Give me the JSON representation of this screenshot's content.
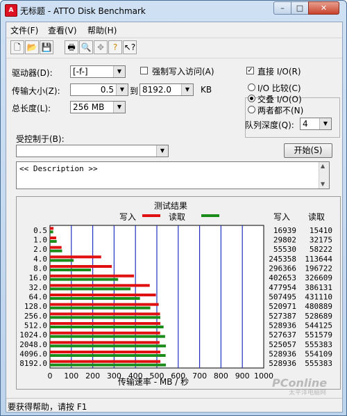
{
  "window": {
    "title": "无标题 - ATTO Disk Benchmark",
    "app_icon": "atto-icon",
    "minimize": "–",
    "maximize": "□",
    "close": "✕"
  },
  "menu": [
    "文件(F)",
    "查看(V)",
    "帮助(H)"
  ],
  "toolbar": [
    "new-icon",
    "open-icon",
    "save-icon",
    "print-icon",
    "print-preview-icon",
    "move-icon",
    "help-icon",
    "context-help-icon"
  ],
  "form": {
    "drive_label": "驱动器(D):",
    "drive_value": "[-f-]",
    "force_write_label": "强制写入访问(A)",
    "transfer_label": "传输大小(Z):",
    "transfer_from": "0.5",
    "to_label": "到",
    "transfer_to": "8192.0",
    "kb_label": "KB",
    "total_length_label": "总长度(L):",
    "total_length_value": "256 MB",
    "direct_io_label": "直接 I/O(R)",
    "io_compare_label": "I/O 比较(C)",
    "overlapped_io_label": "交叠 I/O(O)",
    "neither_label": "两者都不(N)",
    "queue_depth_label": "队列深度(Q):",
    "queue_depth_value": "4",
    "controlled_by_label": "受控制于(B):",
    "controlled_by_value": "",
    "start_button": "开始(S)",
    "description": "<< Description >>"
  },
  "results": {
    "title": "测试结果",
    "write_label": "写入",
    "read_label": "读取",
    "col_write": "写入",
    "col_read": "读取",
    "axis_label": "传输速率 - MB / 秒"
  },
  "chart_data": {
    "type": "bar",
    "orientation": "horizontal",
    "categories": [
      "0.5",
      "1.0",
      "2.0",
      "4.0",
      "8.0",
      "16.0",
      "32.0",
      "64.0",
      "128.0",
      "256.0",
      "512.0",
      "1024.0",
      "2048.0",
      "4096.0",
      "8192.0"
    ],
    "series": [
      {
        "name": "写入",
        "color": "#e01010",
        "values": [
          16939,
          29802,
          55530,
          245358,
          296366,
          402653,
          477954,
          507495,
          520971,
          527387,
          528936,
          527637,
          525057,
          528936,
          528936
        ]
      },
      {
        "name": "读取",
        "color": "#1a8c1a",
        "values": [
          15410,
          32175,
          58222,
          113644,
          196722,
          326609,
          386131,
          431110,
          480889,
          528689,
          544125,
          551579,
          555383,
          554109,
          555383
        ]
      }
    ],
    "xticks": [
      "0",
      "100",
      "200",
      "300",
      "400",
      "500",
      "600",
      "700",
      "800",
      "900",
      "1000"
    ],
    "xlim": [
      0,
      1000
    ],
    "xlabel": "传输速率 - MB / 秒",
    "grid": true,
    "legend": "top"
  },
  "statusbar": {
    "text": "要获得帮助，请按 F1"
  },
  "watermark": {
    "main": "PConline",
    "sub": "太平洋电脑网"
  }
}
